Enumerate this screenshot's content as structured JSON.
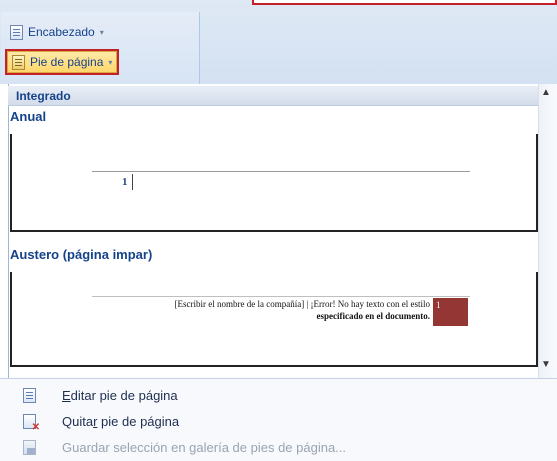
{
  "ribbon": {
    "encabezado_label": "Encabezado",
    "pie_label": "Pie de página",
    "dropdown_glyph": "▾"
  },
  "gallery": {
    "section_header": "Integrado",
    "items": [
      {
        "label": "Anual",
        "preview_number": "1"
      },
      {
        "label": "Austero (página impar)",
        "preview_text_1": "[Escribir el nombre de la compañía] | ¡Error! No hay texto con el estilo",
        "preview_text_2": "especificado en el documento.",
        "preview_number": "1"
      }
    ]
  },
  "menu": {
    "edit": {
      "pre": "",
      "u": "E",
      "post": "ditar pie de página"
    },
    "remove": {
      "pre": "Quita",
      "u": "r",
      "post": " pie de página"
    },
    "save": {
      "label": "Guardar selección en galería de pies de página..."
    }
  },
  "icons": {
    "header_doc": "document-header-icon",
    "footer_doc": "document-footer-icon",
    "scroll_up": "▲",
    "scroll_down": "▼"
  },
  "colors": {
    "highlight_red": "#c4202c",
    "ribbon_text": "#15428b",
    "austero_box": "#943634"
  }
}
